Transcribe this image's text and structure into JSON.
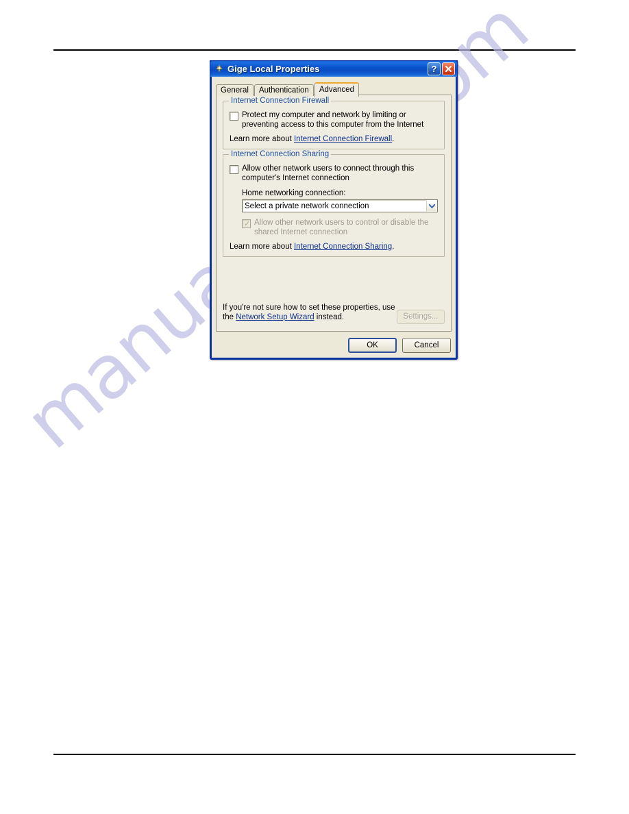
{
  "page": {
    "watermark": "manualshive.com"
  },
  "dialog": {
    "title": "Gige Local Properties",
    "icon": "network-connection-icon",
    "titlebar_buttons": {
      "help": "?",
      "help_name": "help-button",
      "close": "✕",
      "close_name": "close-button"
    },
    "tabs": [
      {
        "label": "General",
        "active": false
      },
      {
        "label": "Authentication",
        "active": false
      },
      {
        "label": "Advanced",
        "active": true
      }
    ],
    "firewall_group": {
      "legend": "Internet Connection Firewall",
      "checkbox": {
        "label": "Protect my computer and network by limiting or preventing access to this computer from the Internet",
        "checked": false,
        "enabled": true
      },
      "learn_prefix": "Learn more about ",
      "learn_link": "Internet Connection Firewall",
      "learn_suffix": "."
    },
    "sharing_group": {
      "legend": "Internet Connection Sharing",
      "checkbox_connect": {
        "label": "Allow other network users to connect through this computer's Internet connection",
        "checked": false,
        "enabled": true
      },
      "home_networking_label": "Home networking connection:",
      "combo": {
        "value": "Select a private network connection",
        "arrow": "chevron-down-icon"
      },
      "checkbox_control": {
        "label": "Allow other network users to control or disable the shared Internet connection",
        "checked": true,
        "enabled": false,
        "tick": "✓"
      },
      "learn_prefix": "Learn more about ",
      "learn_link": "Internet Connection Sharing",
      "learn_suffix": "."
    },
    "footer": {
      "text_part1": "If you're not sure how to set these properties, use the ",
      "link": "Network Setup Wizard",
      "text_part2": " instead.",
      "settings_button": "Settings...",
      "settings_enabled": false
    },
    "buttons": {
      "ok": "OK",
      "cancel": "Cancel"
    }
  },
  "colors": {
    "titlebar_blue": "#0a53cc",
    "dialog_border": "#0a32a0",
    "dialog_face": "#ece9d8",
    "panel_face": "#efece1",
    "group_legend_blue": "#1b4f9c",
    "link_blue": "#0d2f8c",
    "active_tab_accent": "#f0a830",
    "close_red": "#c22d10",
    "watermark": "#b9b9e2"
  }
}
